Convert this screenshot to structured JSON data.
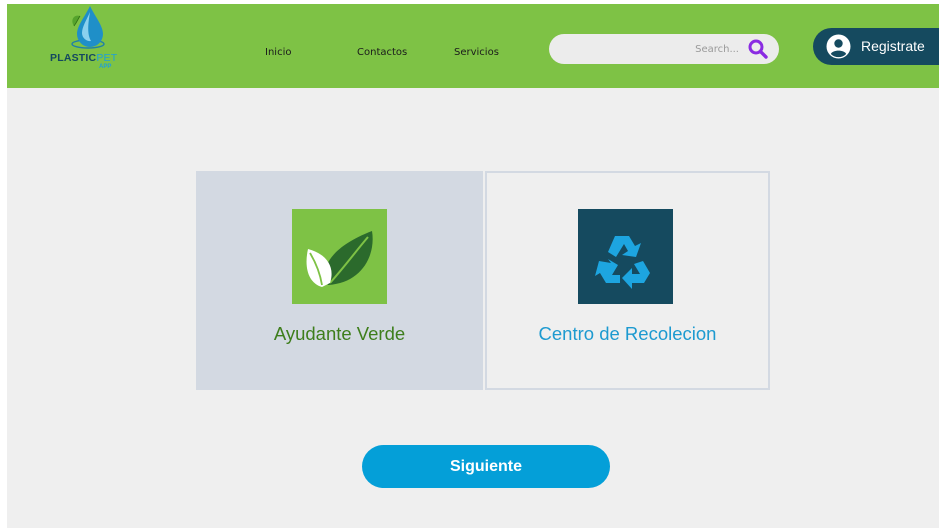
{
  "header": {
    "background_color": "#7ec245",
    "logo": {
      "icon": "water-drop-leaf-icon",
      "brand_main": "PLASTIC",
      "brand_accent": "PET",
      "brand_sub": "APP"
    },
    "nav": [
      {
        "label": "Inicio"
      },
      {
        "label": "Contactos"
      },
      {
        "label": "Servicios"
      }
    ],
    "search": {
      "placeholder": "Search...",
      "value": "",
      "icon": "search-icon",
      "icon_color": "#8a2be2"
    },
    "register": {
      "label": "Registrate",
      "icon": "user-circle-icon",
      "color": "#154a5f"
    }
  },
  "options": [
    {
      "label": "Ayudante Verde",
      "icon": "leaf-icon",
      "tile_color": "#7ec245",
      "label_color": "#3e7e1c",
      "selected": true
    },
    {
      "label": "Centro de Recolecion",
      "icon": "recycle-icon",
      "tile_color": "#154a5f",
      "label_color": "#1d9ad0",
      "selected": false
    }
  ],
  "actions": {
    "next_label": "Siguiente",
    "next_color": "#049fd8"
  }
}
